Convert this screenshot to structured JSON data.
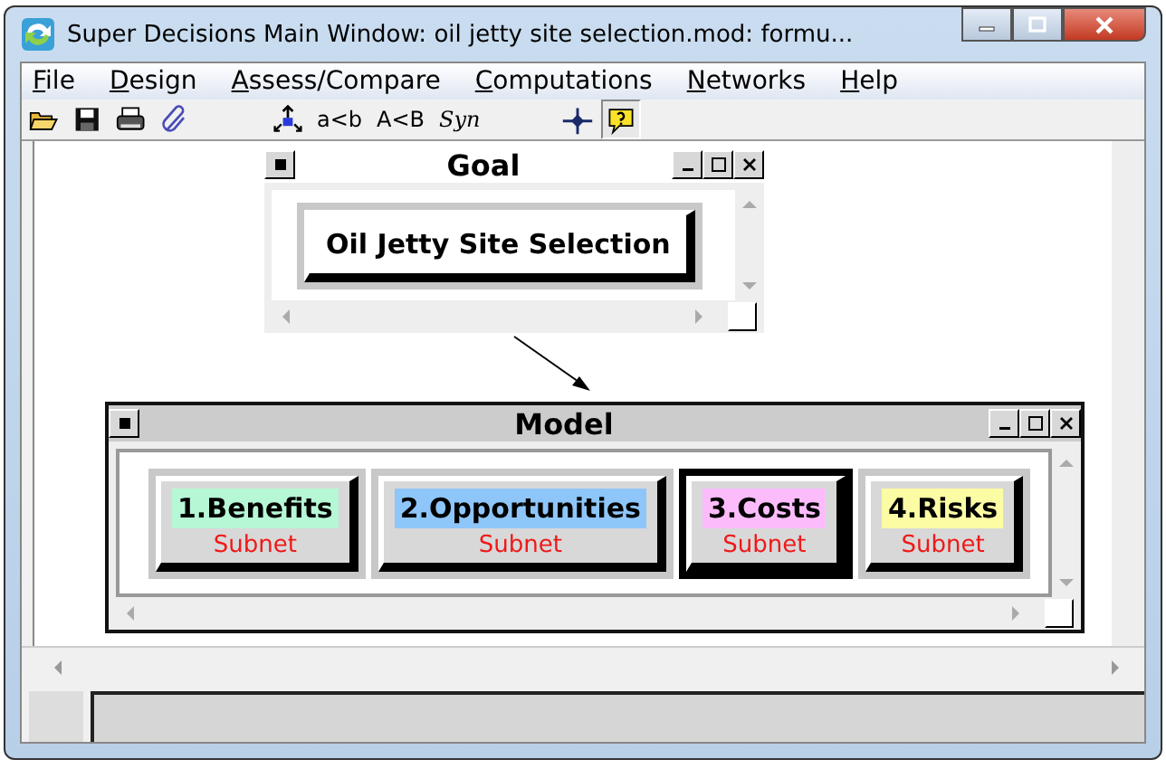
{
  "window": {
    "title": "Super Decisions Main Window: oil jetty site selection.mod: formu..."
  },
  "menu": [
    {
      "label": "File"
    },
    {
      "label": "Design"
    },
    {
      "label": "Assess/Compare"
    },
    {
      "label": "Computations"
    },
    {
      "label": "Networks"
    },
    {
      "label": "Help"
    }
  ],
  "toolbar": [
    {
      "kind": "open"
    },
    {
      "kind": "save"
    },
    {
      "kind": "print"
    },
    {
      "kind": "clip"
    },
    {
      "kind": "gap"
    },
    {
      "kind": "network"
    },
    {
      "kind": "text",
      "label": "a<b"
    },
    {
      "kind": "text",
      "label": "A<B"
    },
    {
      "kind": "text",
      "label": "Syn",
      "italic": true
    },
    {
      "kind": "gap"
    },
    {
      "kind": "cross"
    },
    {
      "kind": "help",
      "pressed": true
    }
  ],
  "subwindows": [
    {
      "title": "Goal",
      "nodes": [
        {
          "label": "Oil Jetty Site Selection",
          "selected": false
        }
      ]
    },
    {
      "title": "Model",
      "nodes": [
        {
          "label": "1.Benefits",
          "sublabel": "Subnet",
          "color": "#b6f7d6",
          "selected": false
        },
        {
          "label": "2.Opportunities",
          "sublabel": "Subnet",
          "color": "#8ec6fa",
          "selected": false
        },
        {
          "label": "3.Costs",
          "sublabel": "Subnet",
          "color": "#fcbcfc",
          "selected": true
        },
        {
          "label": "4.Risks",
          "sublabel": "Subnet",
          "color": "#fcfca4",
          "selected": false
        }
      ]
    }
  ]
}
